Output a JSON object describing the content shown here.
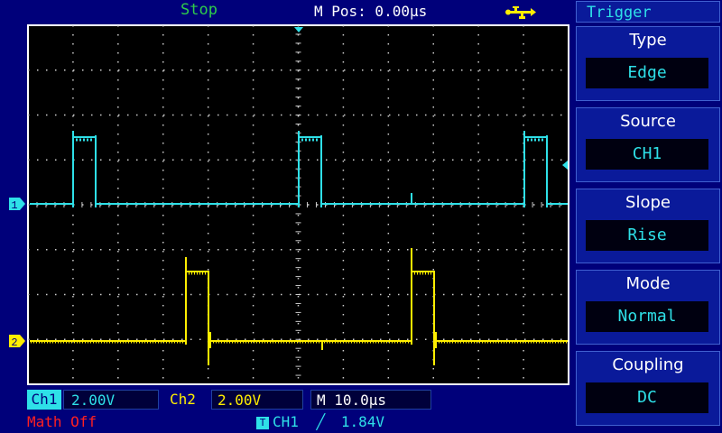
{
  "header": {
    "status": "Stop",
    "mpos": "M Pos: 0.00μs",
    "usb_icon": "usb-icon"
  },
  "menu": {
    "title": "Trigger",
    "items": [
      {
        "label": "Type",
        "value": "Edge"
      },
      {
        "label": "Source",
        "value": "CH1"
      },
      {
        "label": "Slope",
        "value": "Rise"
      },
      {
        "label": "Mode",
        "value": "Normal"
      },
      {
        "label": "Coupling",
        "value": "DC"
      }
    ]
  },
  "bottom": {
    "ch1_label": "Ch1",
    "ch1_scale": "2.00V",
    "ch2_label": "Ch2",
    "ch2_scale": "2.00V",
    "timebase": "M 10.0μs",
    "math": "Math Off",
    "trigger_source": "CH1",
    "trigger_slope_glyph": "╱",
    "trigger_level": "1.84V"
  },
  "markers": {
    "ch1": "1",
    "ch2": "2"
  },
  "colors": {
    "background": "#00007a",
    "ch1": "#2ee0e8",
    "ch2": "#ffee00",
    "status": "#2ecc4a",
    "math": "#ff2020"
  }
}
